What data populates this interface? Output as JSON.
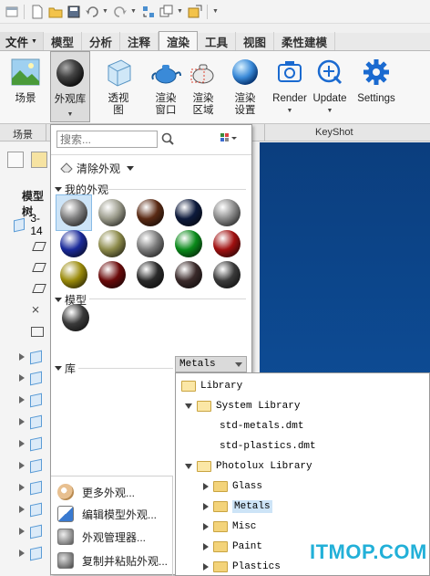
{
  "ribbon_tabs": [
    {
      "label": "文件",
      "has_dropdown": true
    },
    {
      "label": "模型"
    },
    {
      "label": "分析"
    },
    {
      "label": "注释"
    },
    {
      "label": "渲染",
      "active": true
    },
    {
      "label": "工具"
    },
    {
      "label": "视图"
    },
    {
      "label": "柔性建模"
    }
  ],
  "ribbon_buttons": {
    "scene": "场景",
    "appearance_lib": "外观库",
    "perspective_1": "透视",
    "perspective_2": "图",
    "render_window_1": "渲染",
    "render_window_2": "窗口",
    "render_region_1": "渲染",
    "render_region_2": "区域",
    "render_setup_1": "渲染",
    "render_setup_2": "设置",
    "render": "Render",
    "update": "Update",
    "settings": "Settings"
  },
  "ribbon_groups": {
    "scene": "场景",
    "keyshot": "KeyShot"
  },
  "left_panel": {
    "title": "模型树",
    "root_item": "3-14"
  },
  "appearance_panel": {
    "search_placeholder": "搜索...",
    "clear_label": "清除外观",
    "my_appearances": "我的外观",
    "model_section": "模型",
    "library_section": "库",
    "library_dropdown_value": "Metals",
    "swatch_colors": [
      "#7d7d7d",
      "#9a9a8a",
      "#5a2a14",
      "#0d1a3c",
      "#8a8a8a",
      "#1a2a9a",
      "#8c8a4a",
      "#7a7a7a",
      "#0a8a1a",
      "#a01010",
      "#9a8a0a",
      "#6a0a0a",
      "#2a2a2a",
      "#3a2a2a",
      "#3a3a3a"
    ],
    "model_swatch_color": "#3a3a3a",
    "actions": [
      {
        "label": "更多外观..."
      },
      {
        "label": "编辑模型外观..."
      },
      {
        "label": "外观管理器..."
      },
      {
        "label": "复制并粘贴外观..."
      }
    ]
  },
  "library_tree": {
    "root": "Library",
    "system_library": "System Library",
    "std_metals": "std-metals.dmt",
    "std_plastics": "std-plastics.dmt",
    "photolux_library": "Photolux Library",
    "children": [
      "Glass",
      "Metals",
      "Misc",
      "Paint",
      "Plastics"
    ]
  },
  "watermark": "ITMOP.COM"
}
